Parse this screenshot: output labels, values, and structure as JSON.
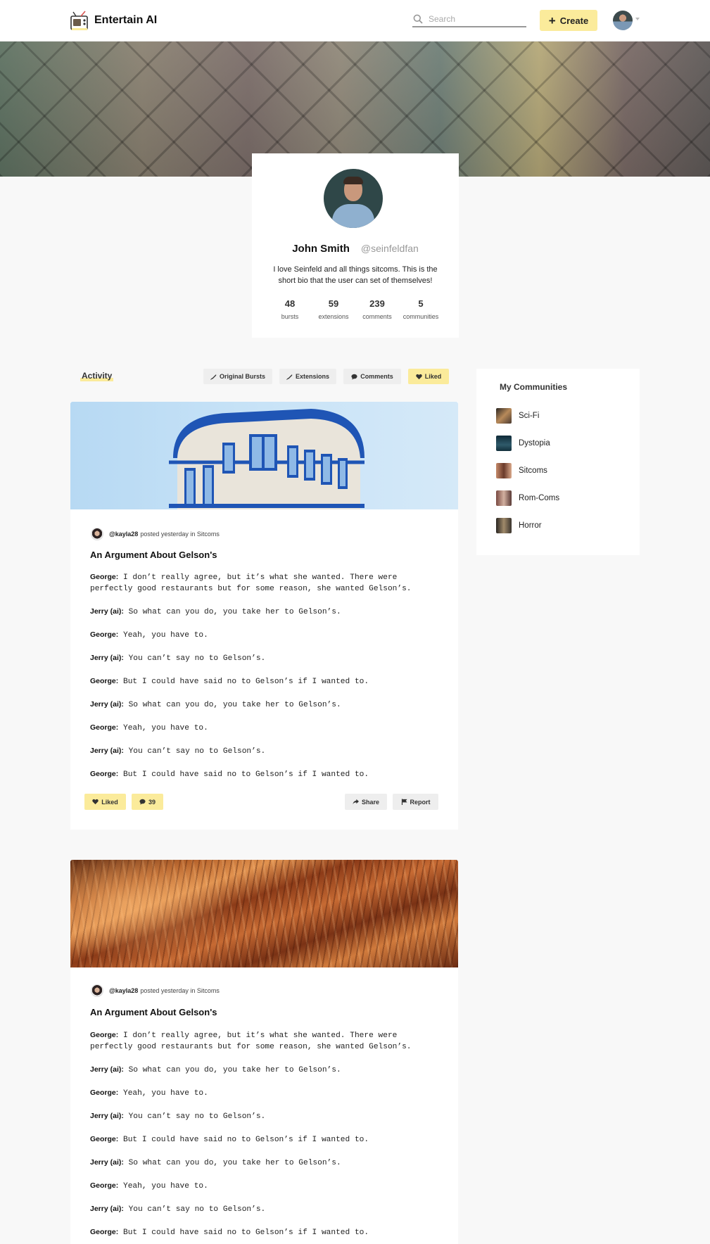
{
  "app": {
    "name": "Entertain AI"
  },
  "header": {
    "search_placeholder": "Search",
    "create_label": "Create"
  },
  "profile": {
    "name": "John Smith",
    "handle": "@seinfeldfan",
    "bio": "I love Seinfeld and all things sitcoms. This is the short bio that the user can set of themselves!",
    "stats": [
      {
        "value": "48",
        "label": "bursts"
      },
      {
        "value": "59",
        "label": "extensions"
      },
      {
        "value": "239",
        "label": "comments"
      },
      {
        "value": "5",
        "label": "communities"
      }
    ]
  },
  "activity": {
    "title": "Activity",
    "filters": [
      {
        "label": "Original Bursts",
        "icon": "feather-icon",
        "active": false
      },
      {
        "label": "Extensions",
        "icon": "feather-icon",
        "active": false
      },
      {
        "label": "Comments",
        "icon": "comment-icon",
        "active": false
      },
      {
        "label": "Liked",
        "icon": "heart-icon",
        "active": true
      }
    ]
  },
  "posts": [
    {
      "image": "blue-building-photo",
      "author": "@kayla28",
      "meta_text": "posted yesterday in Sitcoms",
      "title": "An Argument About Gelson's",
      "lines": [
        {
          "speaker": "George:",
          "text": "I don’t really agree, but it’s what she wanted. There were perfectly good restaurants but for some reason, she wanted Gelson’s."
        },
        {
          "speaker": "Jerry (ai):",
          "text": "So what can you do, you take her to Gelson’s."
        },
        {
          "speaker": "George:",
          "text": "Yeah, you have to."
        },
        {
          "speaker": "Jerry (ai):",
          "text": "You can’t say no to Gelson’s."
        },
        {
          "speaker": "George:",
          "text": "But I could have said no to Gelson’s if I wanted to."
        },
        {
          "speaker": "Jerry (ai):",
          "text": "So what can you do, you take her to Gelson’s."
        },
        {
          "speaker": "George:",
          "text": "Yeah, you have to."
        },
        {
          "speaker": "Jerry (ai):",
          "text": "You can’t say no to Gelson’s."
        },
        {
          "speaker": "George:",
          "text": "But I could have said no to Gelson’s if I wanted to."
        }
      ],
      "actions": {
        "liked_label": "Liked",
        "comment_count": "39",
        "share_label": "Share",
        "report_label": "Report"
      }
    },
    {
      "image": "canyon-photo",
      "author": "@kayla28",
      "meta_text": "posted yesterday in Sitcoms",
      "title": "An Argument About Gelson's",
      "lines": [
        {
          "speaker": "George:",
          "text": "I don’t really agree, but it’s what she wanted. There were perfectly good restaurants but for some reason, she wanted Gelson’s."
        },
        {
          "speaker": "Jerry (ai):",
          "text": "So what can you do, you take her to Gelson’s."
        },
        {
          "speaker": "George:",
          "text": "Yeah, you have to."
        },
        {
          "speaker": "Jerry (ai):",
          "text": "You can’t say no to Gelson’s."
        },
        {
          "speaker": "George:",
          "text": "But I could have said no to Gelson’s if I wanted to."
        },
        {
          "speaker": "Jerry (ai):",
          "text": "So what can you do, you take her to Gelson’s."
        },
        {
          "speaker": "George:",
          "text": "Yeah, you have to."
        },
        {
          "speaker": "Jerry (ai):",
          "text": "You can’t say no to Gelson’s."
        },
        {
          "speaker": "George:",
          "text": "But I could have said no to Gelson’s if I wanted to."
        }
      ]
    }
  ],
  "communities": {
    "title": "My Communities",
    "items": [
      {
        "name": "Sci-Fi",
        "color": "#7a5a3e"
      },
      {
        "name": "Dystopia",
        "color": "#1d3a4a"
      },
      {
        "name": "Sitcoms",
        "color": "#a8684a"
      },
      {
        "name": "Rom-Coms",
        "color": "#8a5a50"
      },
      {
        "name": "Horror",
        "color": "#3e3a36"
      }
    ]
  },
  "colors": {
    "accent": "#fbeb9b",
    "page_bg": "#f8f8f8",
    "button_gray": "#eeeeee"
  }
}
